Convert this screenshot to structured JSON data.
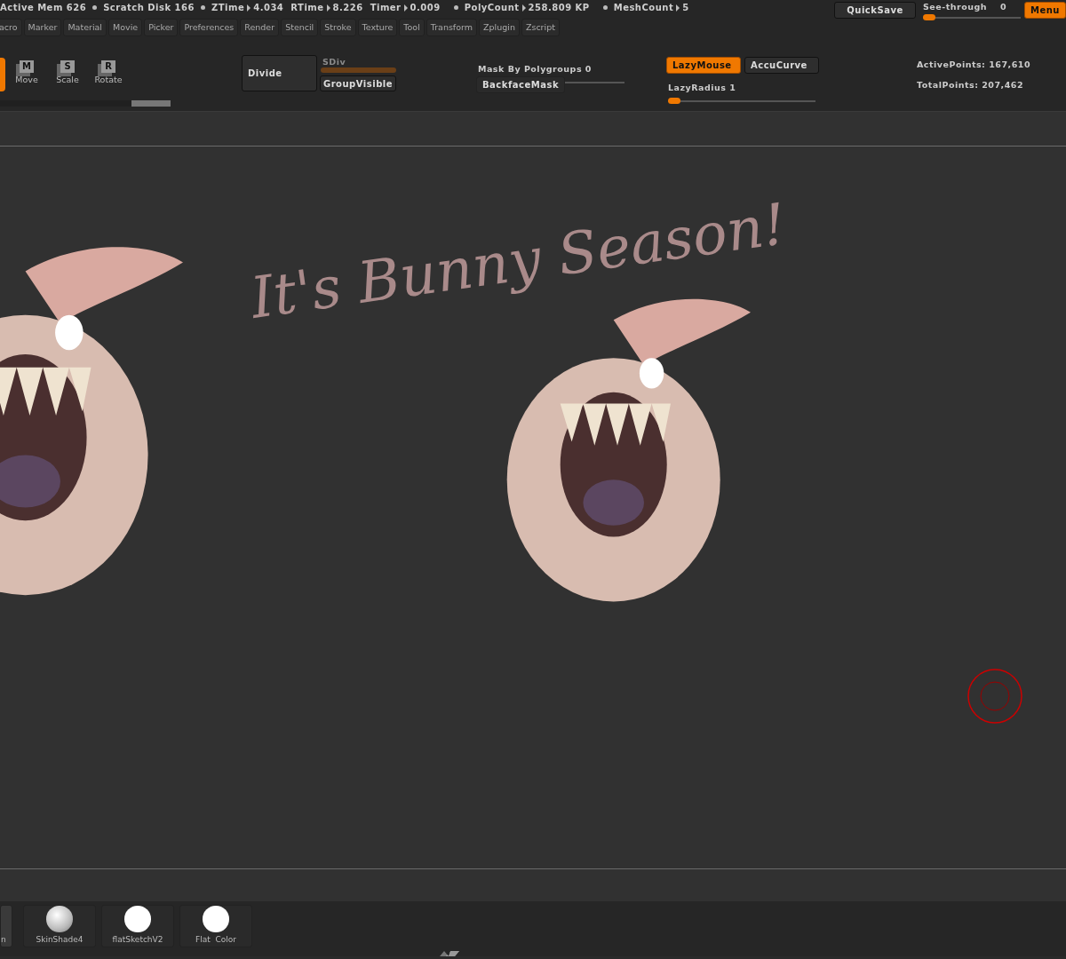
{
  "status_bar": {
    "items": [
      {
        "label": "Active Mem 626",
        "kind": "plain"
      },
      {
        "kind": "dot"
      },
      {
        "label": "Scratch Disk 166",
        "kind": "plain"
      },
      {
        "kind": "dot"
      },
      {
        "label": "ZTime",
        "value": "4.034",
        "kind": "arrow"
      },
      {
        "label": "RTime",
        "value": "8.226",
        "kind": "arrow"
      },
      {
        "label": "Timer",
        "value": "0.009",
        "kind": "arrow"
      },
      {
        "kind": "dot"
      },
      {
        "label": "PolyCount",
        "value": "258.809 KP",
        "kind": "arrow"
      },
      {
        "kind": "dot"
      },
      {
        "label": "MeshCount",
        "value": "5",
        "kind": "arrow"
      }
    ],
    "quicksave": "QuickSave",
    "see_through": {
      "label": "See-through",
      "value": "0",
      "level": 0.05
    },
    "menu_button": "Menu"
  },
  "menus": [
    "acro",
    "Marker",
    "Material",
    "Movie",
    "Picker",
    "Preferences",
    "Render",
    "Stencil",
    "Stroke",
    "Texture",
    "Tool",
    "Transform",
    "Zplugin",
    "Zscript"
  ],
  "toolbar": {
    "transform_tools": [
      {
        "key": "M",
        "label": "Move"
      },
      {
        "key": "S",
        "label": "Scale"
      },
      {
        "key": "R",
        "label": "Rotate"
      }
    ],
    "divide": "Divide",
    "sdiv": {
      "label": "SDiv",
      "disabled": true
    },
    "group_visible": "GroupVisible",
    "mask_by_polygroups": {
      "label": "Mask By Polygroups",
      "value": "0",
      "level": 0.03
    },
    "backface_mask": "BackfaceMask",
    "toggles": [
      {
        "label": "LazyMouse",
        "on": true
      },
      {
        "label": "AccuCurve",
        "on": false
      }
    ],
    "lazy_radius": {
      "label": "LazyRadius",
      "value": "1",
      "level": 0.04
    },
    "stats": [
      {
        "label": "ActivePoints:",
        "value": "167,610"
      },
      {
        "label": "TotalPoints:",
        "value": "207,462"
      }
    ]
  },
  "canvas": {
    "annotation": "It's Bunny Season!"
  },
  "materials": [
    {
      "label": "n",
      "kind": "partial"
    },
    {
      "label": "SkinShade4",
      "kind": "shaded"
    },
    {
      "label": "flatSketchV2",
      "kind": "flat"
    },
    {
      "label": "Flat  Color",
      "kind": "flat"
    }
  ]
}
